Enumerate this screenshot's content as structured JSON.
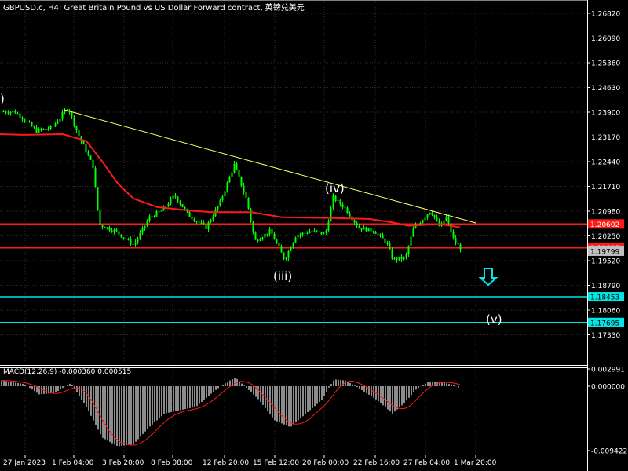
{
  "header": {
    "title": "GBPUSD.c, H4:  Great Britain Pound vs US Dollar Forward contract, 英镑兑美元"
  },
  "indicator": {
    "label": "MACD(12,26,9) -0.000360 0.000515"
  },
  "colors": {
    "background": "#000000",
    "grid": "#2e2e2e",
    "candles": "#00ff00",
    "ma": "#ff1a1a",
    "trendline": "#ffff66",
    "level_red": "#ff1a1a",
    "level_cyan": "#00e5e5",
    "macd_hist": "#c8c8c8",
    "macd_signal": "#ff1a1a",
    "axis_text": "#ffffff"
  },
  "price_axis": {
    "ticks": [
      "1.26820",
      "1.26090",
      "1.25360",
      "1.24630",
      "1.23900",
      "1.23170",
      "1.22440",
      "1.21710",
      "1.20980",
      "1.20250",
      "1.19520",
      "1.18790",
      "1.18060",
      "1.17330"
    ],
    "flags": [
      {
        "value": "1.20602",
        "price": 1.20602,
        "bg": "#ff1a1a",
        "fg": "#ffffff",
        "line": "#ff1a1a"
      },
      {
        "value": "1.19898",
        "price": 1.19898,
        "bg": "#ff1a1a",
        "fg": "#ffffff",
        "line": "#ff1a1a"
      },
      {
        "value": "1.19799",
        "price": 1.19799,
        "bg": "#c0c0c0",
        "fg": "#000000",
        "line": ""
      },
      {
        "value": "1.18453",
        "price": 1.18453,
        "bg": "#00e5e5",
        "fg": "#000000",
        "line": "#00e5e5"
      },
      {
        "value": "1.17695",
        "price": 1.17695,
        "bg": "#00e5e5",
        "fg": "#000000",
        "line": "#00e5e5"
      }
    ]
  },
  "macd_axis": {
    "ticks": [
      "0.002991",
      "0.000000",
      "-0.009422"
    ]
  },
  "time_axis": {
    "labels": [
      "27 Jan 2023",
      "1 Feb 04:00",
      "3 Feb 20:00",
      "8 Feb 08:00",
      "12 Feb 20:00",
      "15 Feb 12:00",
      "20 Feb 00:00",
      "22 Feb 16:00",
      "27 Feb 04:00",
      "1 Mar 20:00"
    ]
  },
  "annotations": {
    "wave_ii": ")",
    "wave_iii": "(iii)",
    "wave_iv": "(iv)",
    "wave_v": "(v)",
    "arrow_icon": "down-arrow-icon"
  }
}
